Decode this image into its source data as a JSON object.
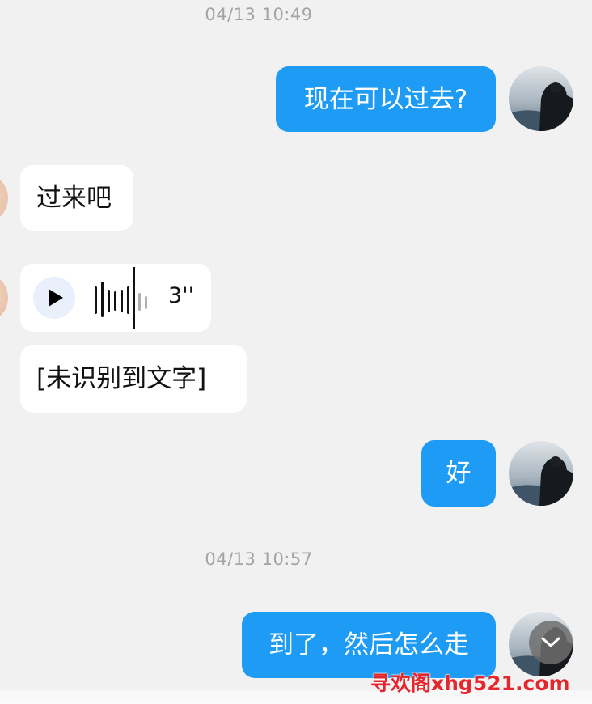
{
  "messages": [
    {
      "type": "timestamp",
      "text": "04/13 10:49"
    },
    {
      "type": "outgoing",
      "text": "现在可以过去?"
    },
    {
      "type": "incoming",
      "text": "过来吧"
    },
    {
      "type": "incoming_voice",
      "duration": "3''"
    },
    {
      "type": "incoming",
      "text": "[未识别到文字]"
    },
    {
      "type": "outgoing",
      "text": "好"
    },
    {
      "type": "timestamp",
      "text": "04/13 10:57"
    },
    {
      "type": "outgoing",
      "text": "到了，然后怎么走"
    }
  ],
  "watermark": "寻欢阁xhg521.com",
  "colors": {
    "background": "#f1f1f1",
    "outgoing_bubble": "#1e9bf5",
    "incoming_bubble": "#ffffff",
    "timestamp_text": "#a4a4a4",
    "watermark": "#e5272d"
  },
  "icons": {
    "play": "play-icon",
    "scroll_down": "chevron-down-icon"
  }
}
